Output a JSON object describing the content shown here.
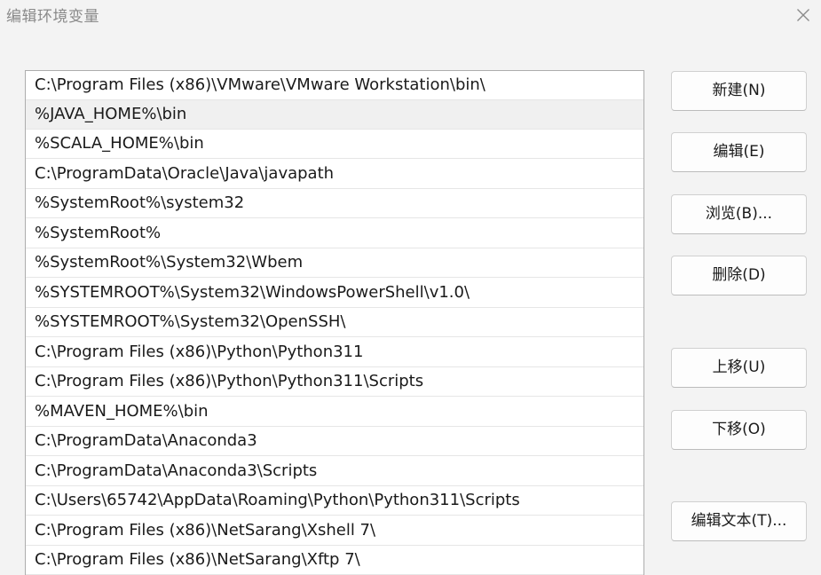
{
  "window": {
    "title": "编辑环境变量",
    "close_icon": "close-icon"
  },
  "path_list": {
    "selected_index": 1,
    "items": [
      "C:\\Program Files (x86)\\VMware\\VMware Workstation\\bin\\",
      "%JAVA_HOME%\\bin",
      "%SCALA_HOME%\\bin",
      "C:\\ProgramData\\Oracle\\Java\\javapath",
      "%SystemRoot%\\system32",
      "%SystemRoot%",
      "%SystemRoot%\\System32\\Wbem",
      "%SYSTEMROOT%\\System32\\WindowsPowerShell\\v1.0\\",
      "%SYSTEMROOT%\\System32\\OpenSSH\\",
      "C:\\Program Files (x86)\\Python\\Python311",
      "C:\\Program Files (x86)\\Python\\Python311\\Scripts",
      "%MAVEN_HOME%\\bin",
      "C:\\ProgramData\\Anaconda3",
      "C:\\ProgramData\\Anaconda3\\Scripts",
      "C:\\Users\\65742\\AppData\\Roaming\\Python\\Python311\\Scripts",
      "C:\\Program Files (x86)\\NetSarang\\Xshell 7\\",
      "C:\\Program Files (x86)\\NetSarang\\Xftp 7\\"
    ]
  },
  "buttons": {
    "new": "新建(N)",
    "edit": "编辑(E)",
    "browse": "浏览(B)...",
    "delete": "删除(D)",
    "move_up": "上移(U)",
    "move_down": "下移(O)",
    "edit_text": "编辑文本(T)..."
  }
}
